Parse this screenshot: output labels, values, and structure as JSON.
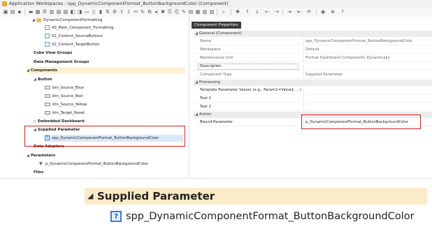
{
  "window": {
    "title": "Application Workspaces - spp_DynamicComponentFormat_ButtonBackgroundColor (Component)"
  },
  "tree": {
    "items": [
      {
        "label": "DynamicComponentFormatting"
      },
      {
        "label": "00_Main_Component_Formatting"
      },
      {
        "label": "01_Content_SourceButtons"
      },
      {
        "label": "02_Content_TargetButton"
      },
      {
        "label": "Cube View Groups"
      },
      {
        "label": "Data Management Groups"
      },
      {
        "label": "Components"
      },
      {
        "label": "Button"
      },
      {
        "label": "btn_Source_Blue"
      },
      {
        "label": "btn_Source_Red"
      },
      {
        "label": "btn_Source_Yellow"
      },
      {
        "label": "btn_Target_Reset"
      },
      {
        "label": "Embedded Dashboard"
      },
      {
        "label": "Supplied Parameter"
      },
      {
        "label": "spp_DynamicComponentFormat_ButtonBackgroundColor"
      },
      {
        "label": "Data Adapters"
      },
      {
        "label": "Parameters"
      },
      {
        "label": "p_DynamicComponentFormat_ButtonBackgroundColor"
      },
      {
        "label": "Files"
      }
    ]
  },
  "properties": {
    "tooltip": "Component Properties",
    "sections": {
      "general": "General (Component)",
      "processing": "Processing",
      "action": "Action"
    },
    "rows": {
      "name": {
        "label": "Name",
        "value": "spp_DynamicComponentFormat_ButtonBackgroundColor"
      },
      "workspace": {
        "label": "Workspace",
        "value": "Default"
      },
      "maintenance_unit": {
        "label": "Maintenance Unit",
        "value": "Format Dashboard Components Dynamically"
      },
      "description": {
        "label": "Description",
        "value": ""
      },
      "component_type": {
        "label": "Component Type",
        "value": "Supplied Parameter"
      },
      "template_param": {
        "label": "Template Parameter Values (e.g., Param1=Value1, ...)",
        "value": ""
      },
      "text1": {
        "label": "Text 1",
        "value": ""
      },
      "text2": {
        "label": "Text 2",
        "value": ""
      },
      "bound_parameter": {
        "label": "Bound Parameter",
        "value": "p_DynamicComponentFormat_ButtonBackgroundColor"
      }
    }
  },
  "zoom": {
    "heading": "Supplied Parameter",
    "item": "spp_DynamicComponentFormat_ButtonBackgroundColor"
  },
  "colors": {
    "highlight_box": "#d12020",
    "section_highlight": "#fcebc7"
  }
}
